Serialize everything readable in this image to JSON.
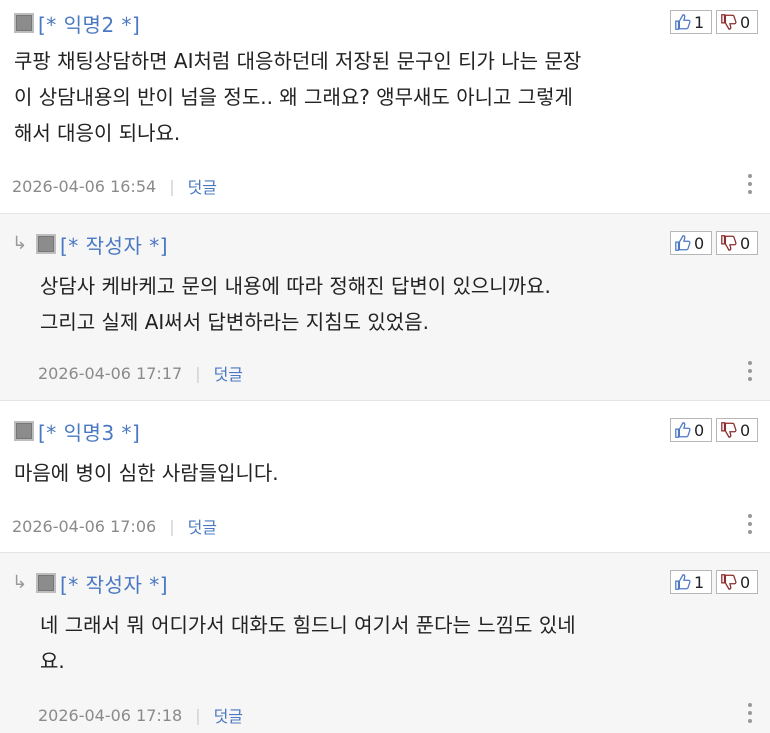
{
  "comments": [
    {
      "author": "[* 익명2 *]",
      "is_reply": false,
      "body": "쿠팡 채팅상담하면 AI처럼 대응하던데 저장된 문구인 티가 나는 문장\n이 상담내용의 반이 넘을 정도.. 왜 그래요? 앵무새도 아니고 그렇게\n해서 대응이 되나요.",
      "timestamp": "2026-04-06 16:54",
      "reply_label": "덧글",
      "upvotes": "1",
      "downvotes": "0"
    },
    {
      "author": "[* 작성자 *]",
      "is_reply": true,
      "body": "상담사 케바케고 문의 내용에 따라 정해진 답변이 있으니까요.\n그리고 실제 AI써서 답변하라는 지침도 있었음.",
      "timestamp": "2026-04-06 17:17",
      "reply_label": "덧글",
      "upvotes": "0",
      "downvotes": "0"
    },
    {
      "author": "[* 익명3 *]",
      "is_reply": false,
      "body": "마음에 병이 심한 사람들입니다.",
      "timestamp": "2026-04-06 17:06",
      "reply_label": "덧글",
      "upvotes": "0",
      "downvotes": "0"
    },
    {
      "author": "[* 작성자 *]",
      "is_reply": true,
      "body": "네 그래서 뭐 어디가서 대화도 힘드니 여기서 푼다는 느낌도 있네\n요.",
      "timestamp": "2026-04-06 17:18",
      "reply_label": "덧글",
      "upvotes": "1",
      "downvotes": "0"
    }
  ],
  "icons": {
    "thumbs_up_color": "#4a78c2",
    "thumbs_down_color": "#8b2b2b",
    "author_color": "#4a78c2",
    "reply_bg": "#f6f6f6"
  }
}
